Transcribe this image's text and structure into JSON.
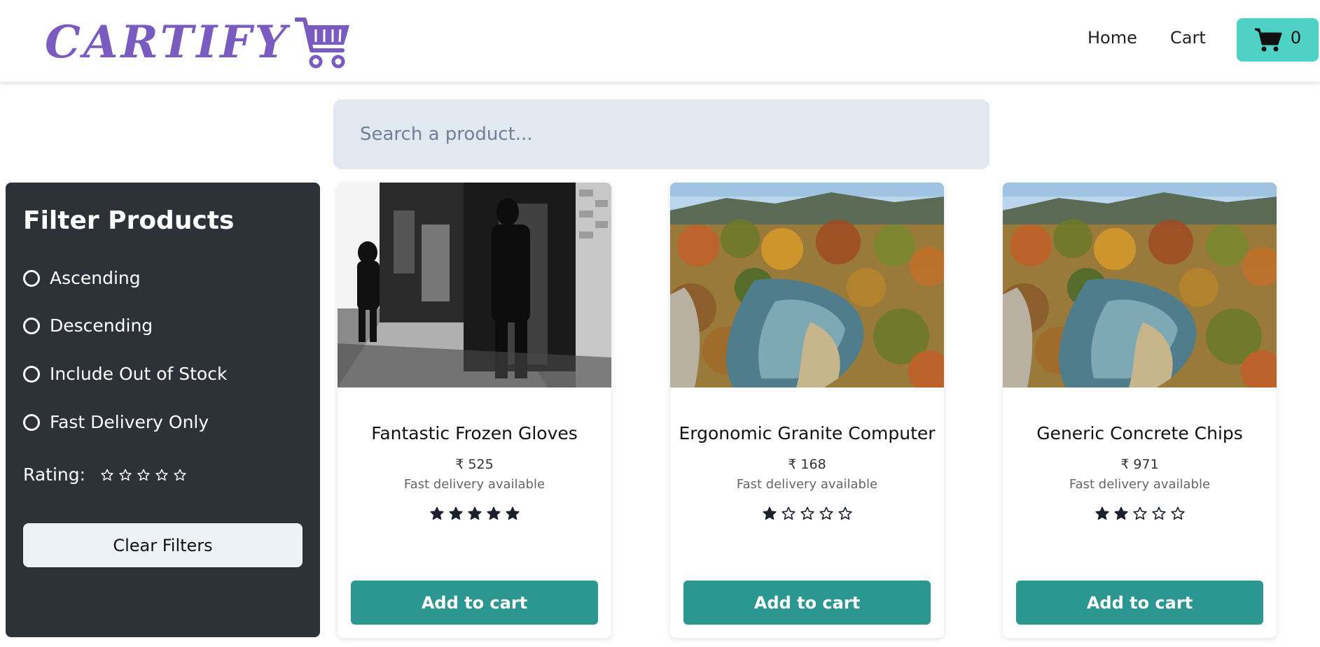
{
  "header": {
    "logo_text": "CARTIFY",
    "nav_home": "Home",
    "nav_cart": "Cart",
    "cart_count": "0",
    "accent_color": "#4fd1c5",
    "logo_color": "#7a5cc0"
  },
  "search": {
    "placeholder": "Search a product..."
  },
  "sidebar": {
    "title": "Filter Products",
    "options": [
      {
        "label": "Ascending"
      },
      {
        "label": "Descending"
      },
      {
        "label": "Include Out of Stock"
      },
      {
        "label": "Fast Delivery Only"
      }
    ],
    "rating_label": "Rating:",
    "rating_value": 0,
    "clear_label": "Clear Filters"
  },
  "products": [
    {
      "name": "Fantastic Frozen Gloves",
      "price": "₹ 525",
      "delivery": "Fast delivery available",
      "rating": 5,
      "button": "Add to cart",
      "image": "black-and-white-street-photo"
    },
    {
      "name": "Ergonomic Granite Computer",
      "price": "₹ 168",
      "delivery": "Fast delivery available",
      "rating": 1,
      "button": "Add to cart",
      "image": "autumn-river-landscape"
    },
    {
      "name": "Generic Concrete Chips",
      "price": "₹ 971",
      "delivery": "Fast delivery available",
      "rating": 2,
      "button": "Add to cart",
      "image": "autumn-river-landscape"
    }
  ],
  "button_color": "#2c9690"
}
